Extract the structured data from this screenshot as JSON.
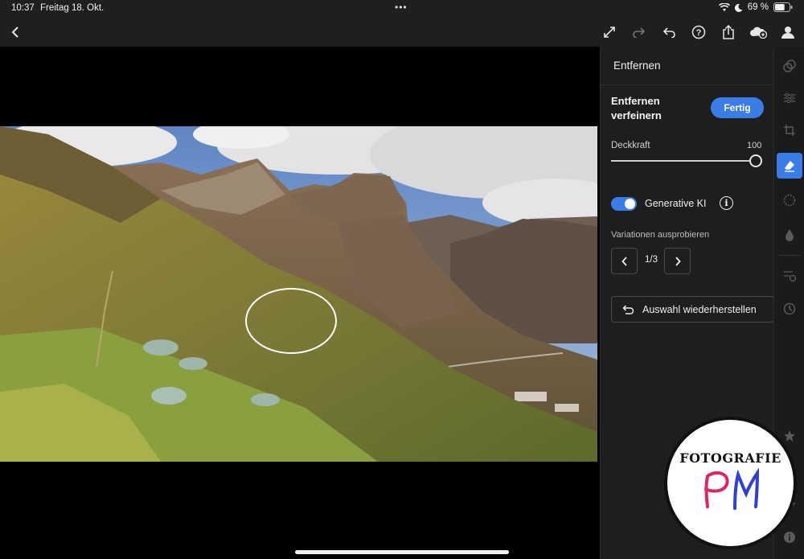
{
  "status_bar": {
    "time": "10:37",
    "date": "Freitag 18. Okt.",
    "more": "•••",
    "battery_percent": "69 %",
    "battery_level": 0.69
  },
  "toolbar": {
    "icons": [
      "back-icon",
      "fullscreen-icon",
      "redo-icon",
      "undo-icon",
      "help-icon",
      "share-icon",
      "cloud-sync-icon",
      "profile-icon"
    ]
  },
  "panel": {
    "title": "Entfernen",
    "refine_label": "Entfernen verfeinern",
    "done_button": "Fertig",
    "opacity_label": "Deckkraft",
    "opacity_value": "100",
    "opacity_level": 1.0,
    "generative_toggle_on": true,
    "generative_label": "Generative KI",
    "variations_label": "Variationen ausprobieren",
    "variation_count": "1/3",
    "restore_button": "Auswahl wiederherstellen"
  },
  "rail": {
    "icons": [
      "presets-icon",
      "adjust-icon",
      "crop-icon",
      "remove-icon",
      "masking-icon",
      "healing-icon",
      "versions-icon",
      "history-icon",
      "rating-icon",
      "comment-icon",
      "tag-icon",
      "info-icon"
    ],
    "active": "remove-icon"
  },
  "watermark": {
    "text": "FOTOGRAFIE",
    "monogram": "PM"
  },
  "colors": {
    "accent": "#3b7de6",
    "panel_bg": "#1e1e1e",
    "toolbar_bg": "#1f1f1f"
  }
}
